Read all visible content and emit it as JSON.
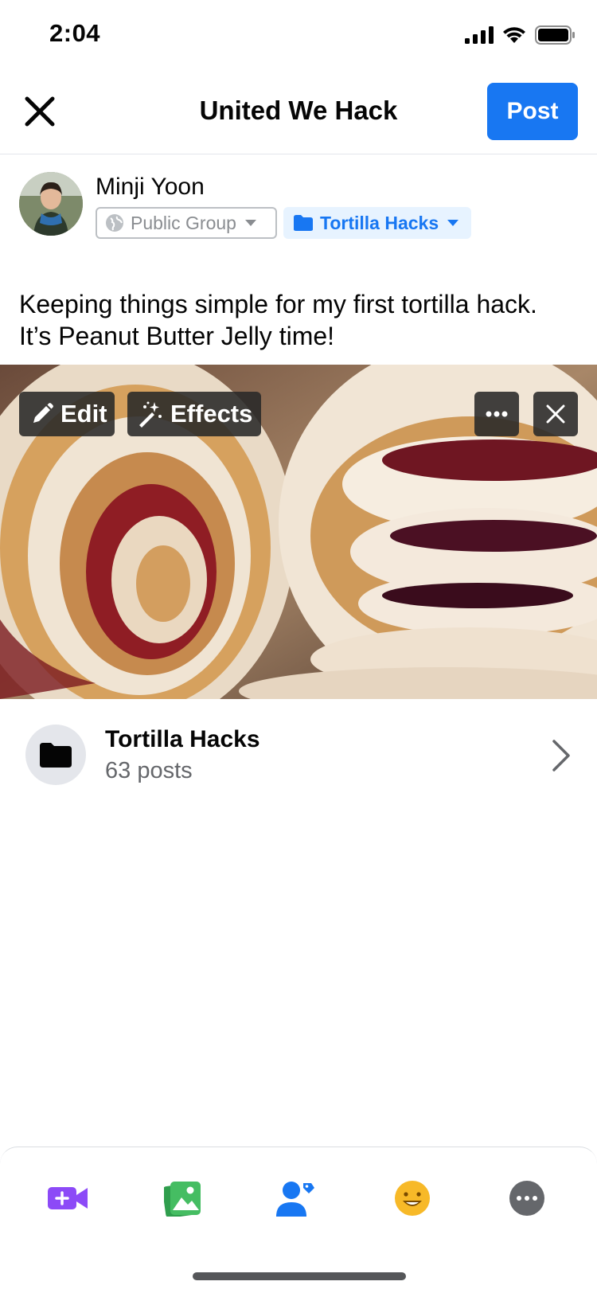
{
  "status_bar": {
    "time": "2:04"
  },
  "header": {
    "title": "United We Hack",
    "post_label": "Post"
  },
  "author": {
    "name": "Minji Yoon",
    "audience_label": "Public Group",
    "album_label": "Tortilla Hacks"
  },
  "post": {
    "text": "Keeping things simple for my first tortilla hack. It’s Peanut Butter Jelly time!"
  },
  "photo": {
    "edit_label": "Edit",
    "effects_label": "Effects"
  },
  "album": {
    "name": "Tortilla Hacks",
    "count": "63 posts"
  },
  "toolbar": {
    "items": [
      {
        "icon": "video-add-icon",
        "color": "#8c4af7"
      },
      {
        "icon": "photo-icon",
        "color": "#45bd62"
      },
      {
        "icon": "tag-people-icon",
        "color": "#1877f2"
      },
      {
        "icon": "feeling-icon",
        "color": "#f7b928"
      },
      {
        "icon": "more-icon",
        "color": "#65676b"
      }
    ]
  },
  "colors": {
    "accent": "#1877f2",
    "chip_bg": "#e7f3ff",
    "secondary_text": "#65676b"
  }
}
